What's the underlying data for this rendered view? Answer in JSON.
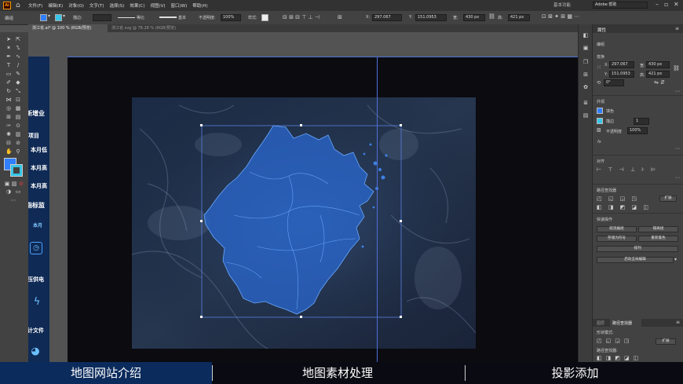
{
  "app": {
    "logo": "Ai"
  },
  "menu": {
    "items": [
      "文件(F)",
      "编辑(E)",
      "对象(O)",
      "文字(T)",
      "选择(S)",
      "效果(C)",
      "视图(V)",
      "窗口(W)",
      "帮助(H)"
    ],
    "workspace": "基本功能",
    "search_placeholder": "Adobe 帮助"
  },
  "control_bar": {
    "object_label": "编组",
    "stroke_label": "描边:",
    "profile_label": "等比",
    "brush_label": "基本",
    "opacity_label": "不透明度:",
    "opacity_value": "100%",
    "style_label": "样式:",
    "x_label": "X:",
    "x_value": "297.067",
    "y_label": "Y:",
    "y_value": "151.0953",
    "w_label": "宽:",
    "w_value": "430 px",
    "h_label": "高:",
    "h_value": "421 px"
  },
  "tabs": [
    {
      "label": "浙江省.ai* @ 100 % (RGB/预览)",
      "active": true
    },
    {
      "label": "浙江省.svg @ 78.28 % (RGB/预览)",
      "active": false
    }
  ],
  "artboard_sidebar": {
    "items": [
      "新增业",
      "项目",
      "本月低",
      "本月高",
      "本月高",
      "指标监",
      "本月",
      "压供电",
      "计文件"
    ]
  },
  "properties_panel": {
    "tab": "属性",
    "section_group": "编组",
    "section_transform": "变换",
    "x_label": "X:",
    "x_value": "297.067",
    "y_label": "Y:",
    "y_value": "151.0953",
    "w_label": "宽:",
    "w_value": "430 px",
    "h_label": "高:",
    "h_value": "421 px",
    "rotate_value": "0°",
    "section_appearance": "外观",
    "fill_label": "填色",
    "stroke_label": "描边",
    "stroke_value": "1",
    "opacity_label": "不透明度",
    "opacity_value": "100%",
    "fx_label": "fx",
    "section_align": "对齐",
    "section_pathfinder": "路径查找器",
    "pathfinder_expand": "扩展",
    "section_quick_actions": "快速操作",
    "btn_ungroup": "取消编组",
    "btn_isolate": "隔离组",
    "btn_save_symbol": "存储为符号",
    "btn_recolor": "重新着色",
    "btn_arrange": "排列",
    "btn_global_edit": "启动全局编辑",
    "bottom_tab_layers": "图层",
    "bottom_tab_pathfinder": "路径查找器",
    "shape_modes_label": "形状模式:",
    "bottom_expand": "扩展",
    "bottom_pathfinder_label": "路径查找器:"
  },
  "caption": {
    "left": "地图网站介绍",
    "middle": "地图素材处理",
    "right": "投影添加"
  },
  "colors": {
    "fill": "#2f7fff",
    "stroke": "#38c6e8",
    "map_fill": "#2a68d0",
    "caption_highlight": "#0b2b5c"
  }
}
